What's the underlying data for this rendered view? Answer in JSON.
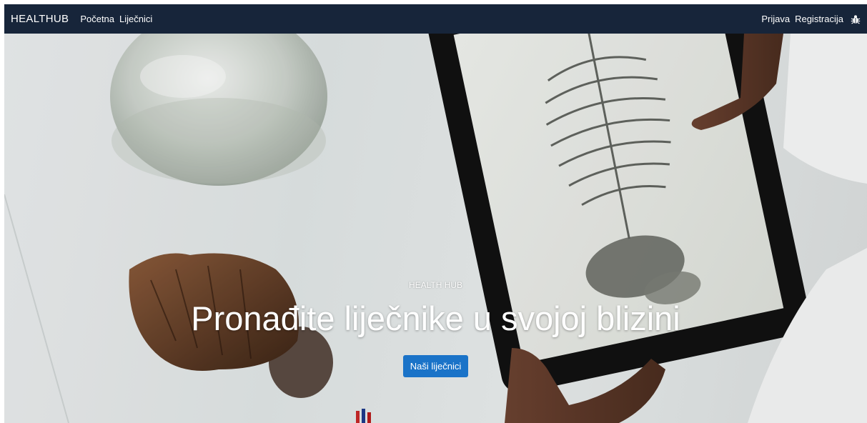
{
  "navbar": {
    "brand": "HEALTHUB",
    "links": [
      {
        "label": "Početna"
      },
      {
        "label": "Liječnici"
      }
    ],
    "right_links": [
      {
        "label": "Prijava"
      },
      {
        "label": "Registracija"
      }
    ],
    "bug_icon": "bug-icon"
  },
  "hero": {
    "eyebrow": "HEALTH HUB",
    "headline": "Pronađite liječnike u svojoj blizini",
    "cta_label": "Naši liječnici"
  },
  "colors": {
    "navbar_bg": "#17253a",
    "cta_bg": "#1a73c8",
    "text": "#ffffff"
  }
}
